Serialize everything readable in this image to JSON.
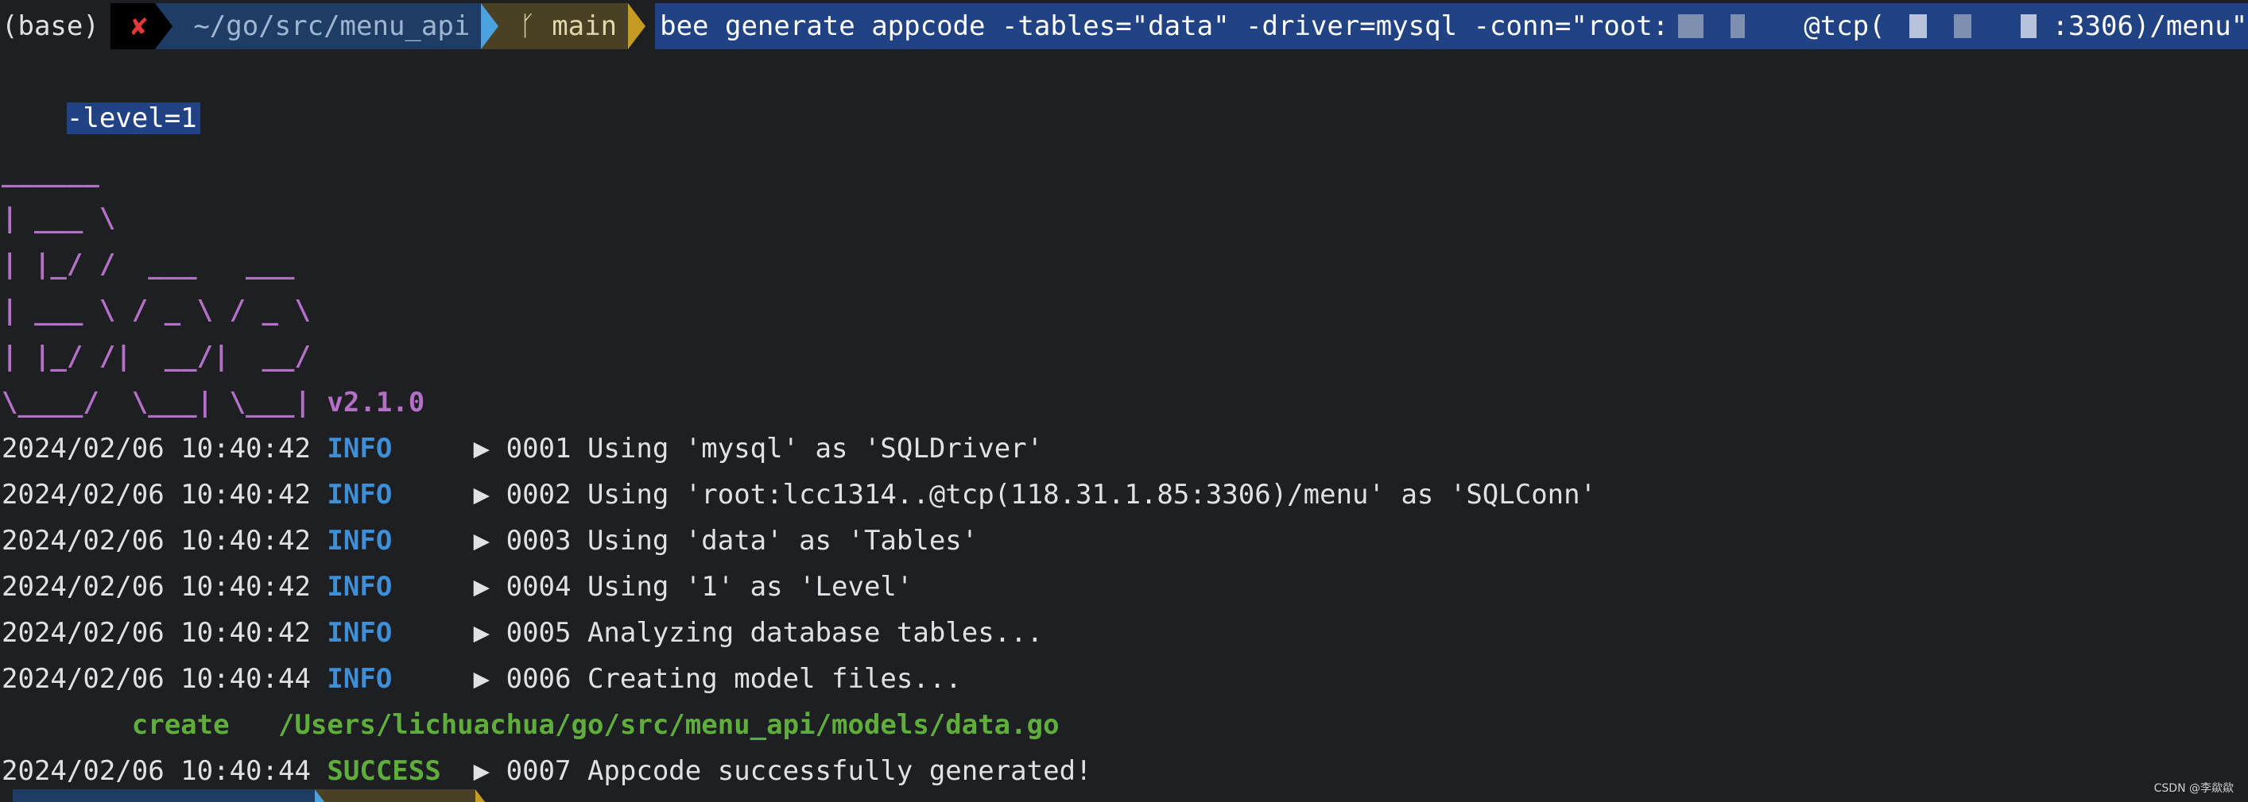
{
  "prompt": {
    "env": "(base)",
    "status_glyph": "✘",
    "path": "~/go/src/menu_api",
    "git_glyph": "ᚴ",
    "branch": "main"
  },
  "command": {
    "part1": "bee generate appcode -tables=\"data\" -driver=mysql -conn=\"root:",
    "part2": "@tcp(",
    "part3": ":3306)/menu\"",
    "line2": "-level=1"
  },
  "banner": {
    "lines": [
      "______",
      "| ___ \\",
      "| |_/ /  ___   ___",
      "| ___ \\ / _ \\ / _ \\",
      "| |_/ /|  __/|  __/",
      "\\____/  \\___| \\___|"
    ],
    "version": "v2.1.0"
  },
  "logs": [
    {
      "ts": "2024/02/06 10:40:42",
      "level": "INFO",
      "msg": "▶ 0001 Using 'mysql' as 'SQLDriver'"
    },
    {
      "ts": "2024/02/06 10:40:42",
      "level": "INFO",
      "msg": "▶ 0002 Using 'root:lcc1314..@tcp(118.31.1.85:3306)/menu' as 'SQLConn'"
    },
    {
      "ts": "2024/02/06 10:40:42",
      "level": "INFO",
      "msg": "▶ 0003 Using 'data' as 'Tables'"
    },
    {
      "ts": "2024/02/06 10:40:42",
      "level": "INFO",
      "msg": "▶ 0004 Using '1' as 'Level'"
    },
    {
      "ts": "2024/02/06 10:40:42",
      "level": "INFO",
      "msg": "▶ 0005 Analyzing database tables..."
    },
    {
      "ts": "2024/02/06 10:40:44",
      "level": "INFO",
      "msg": "▶ 0006 Creating model files..."
    }
  ],
  "create_line": {
    "action": "create",
    "file": "/Users/lichuachua/go/src/menu_api/models/data.go"
  },
  "final_log": {
    "ts": "2024/02/06 10:40:44",
    "level": "SUCCESS",
    "msg": "▶ 0007 Appcode successfully generated!"
  },
  "watermark": "CSDN @李歘歘",
  "colors": {
    "background": "#1e1f22",
    "selection": "#214283",
    "banner": "#b46fc7",
    "info": "#3c8fd8",
    "success": "#5fae3c"
  }
}
